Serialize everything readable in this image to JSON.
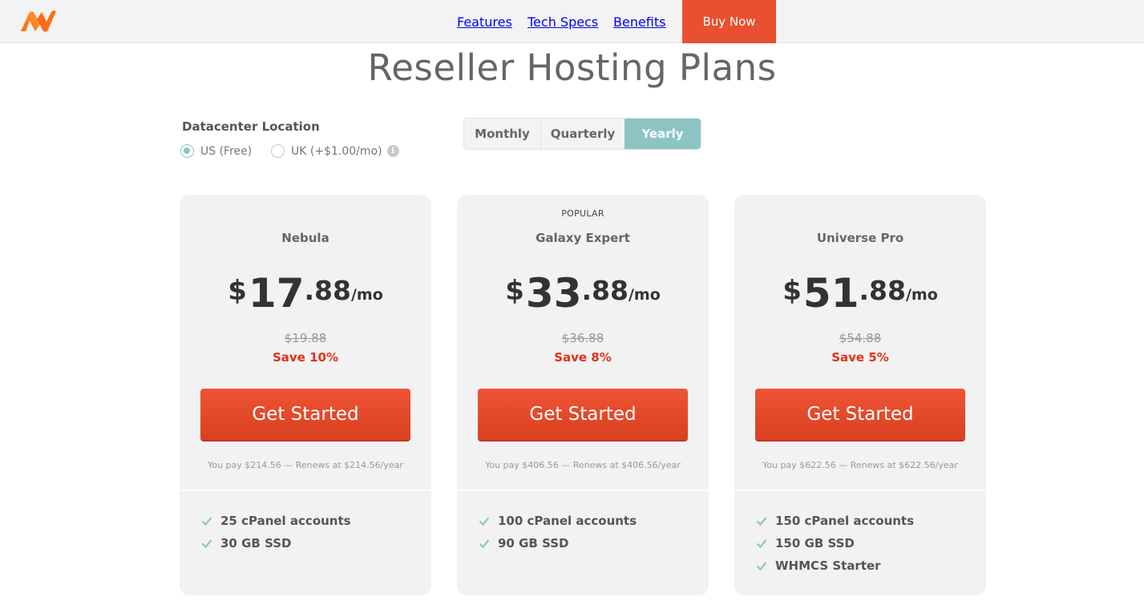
{
  "header": {
    "nav": [
      "Features",
      "Tech Specs",
      "Benefits"
    ],
    "buy_now": "Buy Now"
  },
  "page_title": "Reseller Hosting Plans",
  "datacenter": {
    "label": "Datacenter Location",
    "options": [
      {
        "label": "US (Free)",
        "selected": true
      },
      {
        "label": "UK (+$1.00/mo)",
        "selected": false
      }
    ],
    "info_glyph": "i"
  },
  "billing": {
    "options": [
      "Monthly",
      "Quarterly",
      "Yearly"
    ],
    "selected": "Yearly"
  },
  "colors": {
    "accent_orange": "#e9502f",
    "teal": "#8cc4c4",
    "save_red": "#e2311a"
  },
  "plans": [
    {
      "badge": "",
      "name": "Nebula",
      "currency": "$",
      "price_whole": "17",
      "price_cents": ".88",
      "per": "/mo",
      "old_price": "$19.88",
      "save": "Save 10%",
      "cta": "Get Started",
      "renew": "You pay $214.56 — Renews at $214.56/year",
      "features": [
        "25 cPanel accounts",
        "30 GB SSD"
      ]
    },
    {
      "badge": "POPULAR",
      "name": "Galaxy Expert",
      "currency": "$",
      "price_whole": "33",
      "price_cents": ".88",
      "per": "/mo",
      "old_price": "$36.88",
      "save": "Save 8%",
      "cta": "Get Started",
      "renew": "You pay $406.56 — Renews at $406.56/year",
      "features": [
        "100 cPanel accounts",
        "90 GB SSD"
      ]
    },
    {
      "badge": "",
      "name": "Universe Pro",
      "currency": "$",
      "price_whole": "51",
      "price_cents": ".88",
      "per": "/mo",
      "old_price": "$54.88",
      "save": "Save 5%",
      "cta": "Get Started",
      "renew": "You pay $622.56 — Renews at $622.56/year",
      "features": [
        "150 cPanel accounts",
        "150 GB SSD",
        "WHMCS Starter"
      ]
    }
  ]
}
